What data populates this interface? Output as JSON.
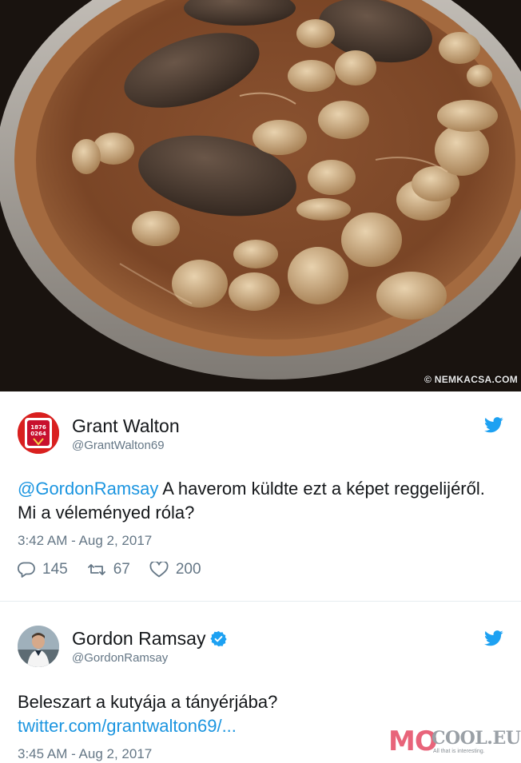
{
  "photo": {
    "watermark": "© NEMKACSA.COM"
  },
  "tweets": [
    {
      "name": "Grant Walton",
      "handle": "@GrantWalton69",
      "mention": "@GordonRamsay",
      "text": " A haverom küldte ezt a képet reggelijéről. Mi a véleményed róla?",
      "time": "3:42 AM - Aug 2, 2017",
      "replies": "145",
      "retweets": "67",
      "likes": "200",
      "avatar_icon": "liverpool-crest-icon"
    },
    {
      "name": "Gordon Ramsay",
      "handle": "@GordonRamsay",
      "verified": true,
      "text": "Beleszart a kutyája a tányérjába?",
      "link": "twitter.com/grantwalton69/...",
      "time": "3:45 AM - Aug 2, 2017",
      "avatar_icon": "chef-photo-icon"
    }
  ],
  "site_logo": {
    "mo": "MO",
    "cool": "COOL.EU",
    "tagline": "All that is interesting."
  },
  "colors": {
    "link_blue": "#1b95e0",
    "twitter_blue": "#1da1f2",
    "meta_gray": "#657786",
    "logo_pink": "#e8647a"
  }
}
